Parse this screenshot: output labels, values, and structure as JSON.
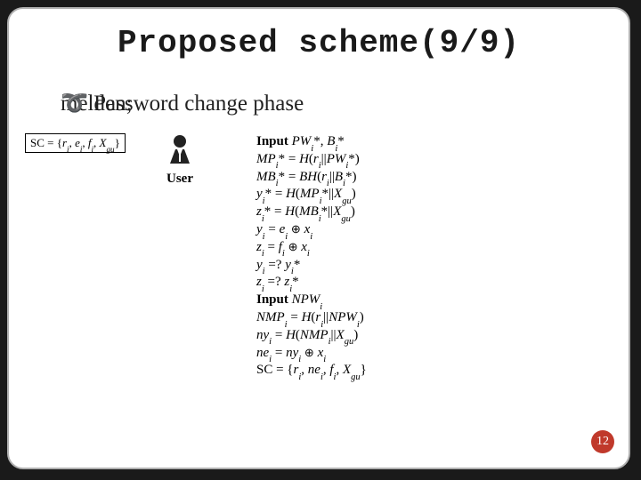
{
  "title": "Proposed scheme(9/9)",
  "section": "Password change phase",
  "sc_box": "SC = {rᵢ, eᵢ, fᵢ, X_gu}",
  "user_label": "User",
  "steps": {
    "s1": "Input PWᵢ*, Bᵢ*",
    "s2": "MPᵢ* = H(rᵢ||PWᵢ*)",
    "s3": "MBᵢ* = BH(rᵢ||Bᵢ*)",
    "s4": "yᵢ* = H(MPᵢ*||X_gu)",
    "s5": "zᵢ* = H(MBᵢ*||X_gu)",
    "s6": "yᵢ = eᵢ ⊕ xᵢ",
    "s7": "zᵢ = fᵢ ⊕ xᵢ",
    "s8": "yᵢ =? yᵢ*",
    "s9": "zᵢ =? zᵢ*",
    "s10": "Input NPWᵢ",
    "s11": "NMPᵢ = H(rᵢ||NPWᵢ)",
    "s12": "nyᵢ = H(NMPᵢ||X_gu)",
    "s13": "neᵢ = nyᵢ ⊕ xᵢ",
    "s14": "SC = {rᵢ, neᵢ, fᵢ, X_gu}"
  },
  "page_number": "12"
}
